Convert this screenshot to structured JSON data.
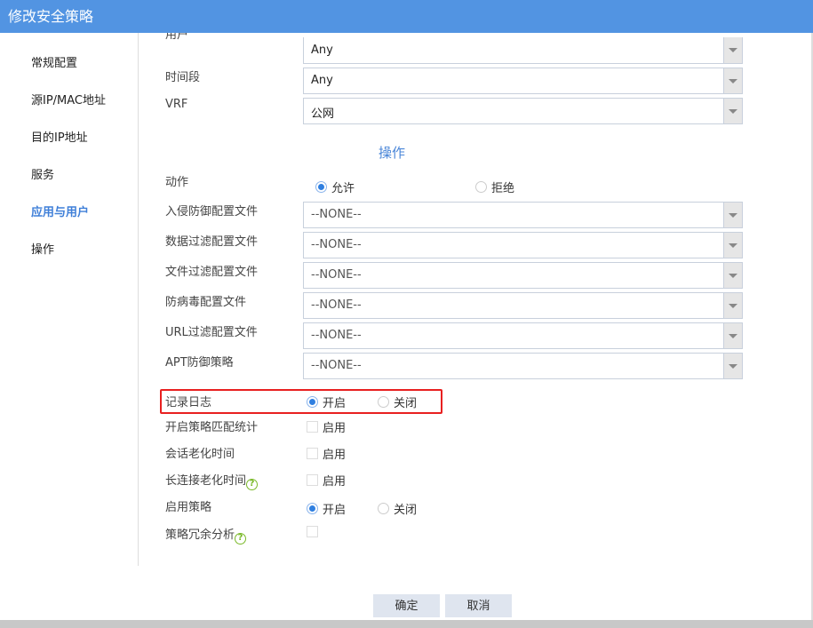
{
  "title": "修改安全策略",
  "sidebar": {
    "items": [
      {
        "label": "常规配置"
      },
      {
        "label": "源IP/MAC地址"
      },
      {
        "label": "目的IP地址"
      },
      {
        "label": "服务"
      },
      {
        "label": "应用与用户",
        "active": true
      },
      {
        "label": "操作"
      }
    ]
  },
  "top_fields": [
    {
      "label": "用户",
      "value": "Any"
    },
    {
      "label": "时间段",
      "value": "Any"
    },
    {
      "label": "VRF",
      "value": "公网"
    }
  ],
  "section_title": "操作",
  "action": {
    "label": "动作",
    "options": [
      "允许",
      "拒绝"
    ],
    "selected": "允许"
  },
  "profiles": [
    {
      "label": "入侵防御配置文件",
      "value": "--NONE--"
    },
    {
      "label": "数据过滤配置文件",
      "value": "--NONE--"
    },
    {
      "label": "文件过滤配置文件",
      "value": "--NONE--"
    },
    {
      "label": "防病毒配置文件",
      "value": "--NONE--"
    },
    {
      "label": "URL过滤配置文件",
      "value": "--NONE--"
    },
    {
      "label": "APT防御策略",
      "value": "--NONE--"
    }
  ],
  "log": {
    "label": "记录日志",
    "on": "开启",
    "off": "关闭",
    "selected": "开启"
  },
  "checks": [
    {
      "label": "开启策略匹配统计",
      "text": "启用",
      "checked": false
    },
    {
      "label": "会话老化时间",
      "text": "启用",
      "checked": false
    },
    {
      "label": "长连接老化时间",
      "text": "启用",
      "checked": false,
      "help": true
    }
  ],
  "enable": {
    "label": "启用策略",
    "on": "开启",
    "off": "关闭",
    "selected": "开启"
  },
  "redundancy": {
    "label": "策略冗余分析",
    "checked": false,
    "help": true
  },
  "help_glyph": "?",
  "buttons": {
    "ok": "确定",
    "cancel": "取消"
  },
  "colors": {
    "titlebar": "#5294e2",
    "accent": "#2f7fe0",
    "highlight": "#e82020"
  }
}
